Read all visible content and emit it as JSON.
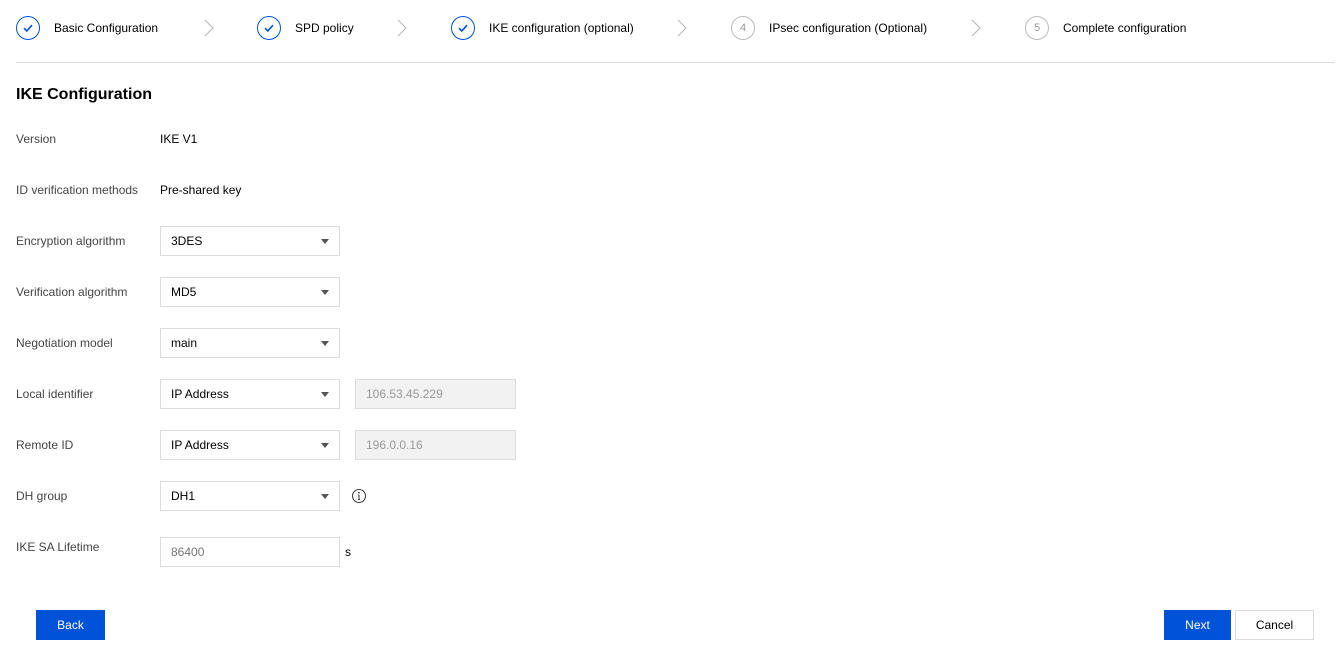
{
  "steps": [
    {
      "num": "1",
      "label": "Basic Configuration",
      "status": "done"
    },
    {
      "num": "2",
      "label": "SPD policy",
      "status": "done"
    },
    {
      "num": "3",
      "label": "IKE configuration (optional)",
      "status": "done"
    },
    {
      "num": "4",
      "label": "IPsec configuration (Optional)",
      "status": "todo"
    },
    {
      "num": "5",
      "label": "Complete configuration",
      "status": "todo"
    }
  ],
  "form": {
    "title": "IKE Configuration",
    "version": {
      "label": "Version",
      "value": "IKE V1"
    },
    "id_verification": {
      "label": "ID verification methods",
      "value": "Pre-shared key"
    },
    "encryption": {
      "label": "Encryption algorithm",
      "value": "3DES"
    },
    "verification": {
      "label": "Verification algorithm",
      "value": "MD5"
    },
    "negotiation": {
      "label": "Negotiation model",
      "value": "main"
    },
    "local_identifier": {
      "label": "Local identifier",
      "type": "IP Address",
      "value": "106.53.45.229"
    },
    "remote_id": {
      "label": "Remote ID",
      "type": "IP Address",
      "value": "196.0.0.16"
    },
    "dh_group": {
      "label": "DH group",
      "value": "DH1"
    },
    "sa_lifetime": {
      "label": "IKE SA Lifetime",
      "placeholder": "86400",
      "unit": "s"
    }
  },
  "footer": {
    "back_label": "Back",
    "next_label": "Next",
    "cancel_label": "Cancel"
  },
  "colors": {
    "primary": "#0052d9",
    "border": "#dcdcdc",
    "readonly_bg": "#f2f2f2"
  },
  "icons": {
    "step_done": "check-icon",
    "dh_info": "info-icon",
    "step_separator": "chevron-right-icon",
    "select": "caret-down-icon"
  }
}
